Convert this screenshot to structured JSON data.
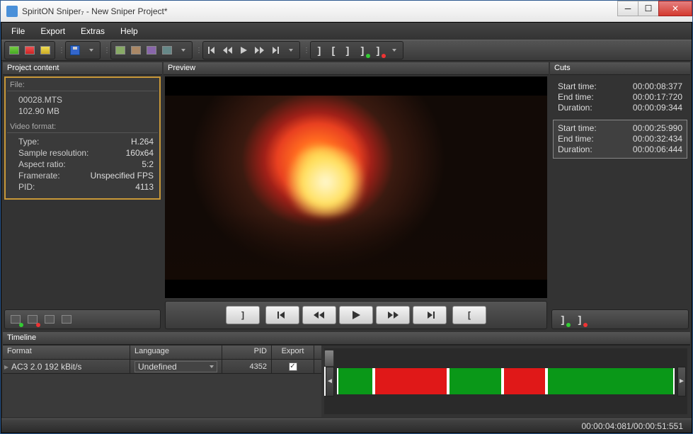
{
  "title": "SpiritON Sniper₇ - New Sniper Project*",
  "menu": {
    "file": "File",
    "export": "Export",
    "extras": "Extras",
    "help": "Help"
  },
  "panels": {
    "project": "Project content",
    "preview": "Preview",
    "cuts": "Cuts",
    "timeline": "Timeline"
  },
  "file_section": {
    "header": "File:",
    "name": "00028.MTS",
    "size": "102.90 MB"
  },
  "video_section": {
    "header": "Video format:",
    "rows": [
      {
        "k": "Type:",
        "v": "H.264"
      },
      {
        "k": "Sample resolution:",
        "v": "160x64"
      },
      {
        "k": "Aspect ratio:",
        "v": "5:2"
      },
      {
        "k": "Framerate:",
        "v": "Unspecified FPS"
      },
      {
        "k": "PID:",
        "v": "4113"
      }
    ]
  },
  "cuts_labels": {
    "start": "Start time:",
    "end": "End time:",
    "dur": "Duration:"
  },
  "cuts": [
    {
      "start": "00:00:08:377",
      "end": "00:00:17:720",
      "dur": "00:00:09:344",
      "selected": false
    },
    {
      "start": "00:00:25:990",
      "end": "00:00:32:434",
      "dur": "00:00:06:444",
      "selected": true
    }
  ],
  "track_headers": {
    "format": "Format",
    "language": "Language",
    "pid": "PID",
    "export": "Export"
  },
  "tracks": [
    {
      "format": "AC3 2.0 192 kBit/s",
      "language": "Undefined",
      "pid": "4352",
      "export": true
    }
  ],
  "timeline_segments": [
    {
      "color": "green",
      "width": 11
    },
    {
      "color": "red",
      "width": 22
    },
    {
      "color": "green",
      "width": 16
    },
    {
      "color": "red",
      "width": 13
    },
    {
      "color": "green",
      "width": 38
    }
  ],
  "playhead_percent": 9,
  "status": {
    "pos": "00:00:04:081",
    "total": "00:00:51:551",
    "sep": " / "
  }
}
